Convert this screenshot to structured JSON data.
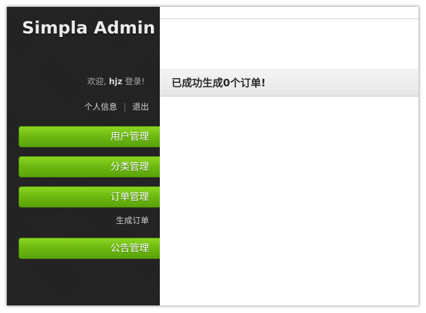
{
  "sidebar": {
    "brand": "Simpla Admin",
    "welcome": {
      "prefix": "欢迎, ",
      "username": "hjz",
      "suffix": " 登录!"
    },
    "profile_link": "个人信息",
    "separator": "|",
    "logout_link": "退出",
    "nav": [
      {
        "label": "用户管理"
      },
      {
        "label": "分类管理"
      },
      {
        "label": "订单管理"
      },
      {
        "label": "公告管理"
      }
    ],
    "order_sub_item": "生成订单"
  },
  "content": {
    "message": "已成功生成0个订单!"
  },
  "colors": {
    "sidebar_bg": "#232323",
    "nav_green": "#6fba12",
    "message_bg": "#eeeeee"
  }
}
